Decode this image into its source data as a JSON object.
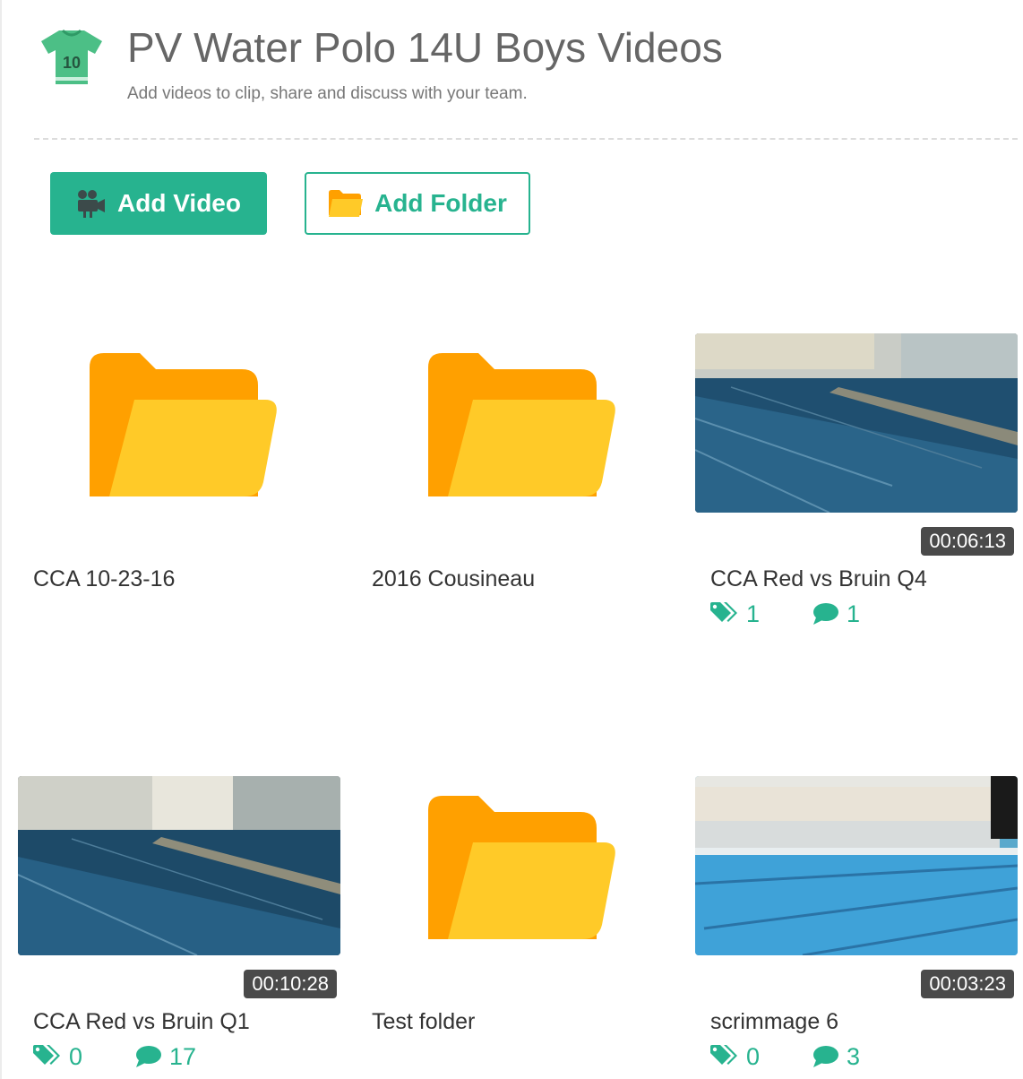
{
  "header": {
    "jersey_number": "10",
    "title": "PV Water Polo 14U Boys Videos",
    "subtitle": "Add videos to clip, share and discuss with your team."
  },
  "actions": {
    "add_video": "Add Video",
    "add_folder": "Add Folder"
  },
  "colors": {
    "accent": "#27b38f",
    "folder_back": "#ffa000",
    "folder_front": "#ffca28",
    "duration_bg": "#4a4a4a"
  },
  "items": [
    {
      "type": "folder",
      "name": "CCA 10-23-16"
    },
    {
      "type": "folder",
      "name": "2016 Cousineau"
    },
    {
      "type": "video",
      "name": "CCA Red vs Bruin Q4",
      "duration": "00:06:13",
      "tags": "1",
      "comments": "1"
    },
    {
      "type": "video",
      "name": "CCA Red vs Bruin Q1",
      "duration": "00:10:28",
      "tags": "0",
      "comments": "17"
    },
    {
      "type": "folder",
      "name": "Test folder"
    },
    {
      "type": "video",
      "name": "scrimmage 6",
      "duration": "00:03:23",
      "tags": "0",
      "comments": "3"
    }
  ],
  "icons": {
    "header": "jersey-icon",
    "add_video": "video-camera-icon",
    "add_folder": "folder-icon",
    "tags": "tags-icon",
    "comments": "comment-icon"
  }
}
